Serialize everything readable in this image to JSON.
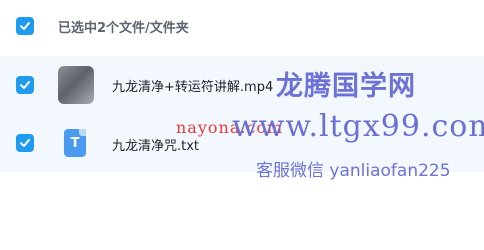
{
  "selection": {
    "summary": "已选中2个文件/文件夹",
    "all_checked": true
  },
  "files": [
    {
      "name": "九龙清净+转运符讲解.mp4",
      "type": "video",
      "checked": true
    },
    {
      "name": "九龙清净咒.txt",
      "type": "text",
      "icon_letter": "T",
      "checked": true
    }
  ],
  "watermark": {
    "title": "龙腾国学网",
    "url": "www.ltgx99.com",
    "red_text": "nayona.com",
    "service": "客服微信 yanliaofan225"
  },
  "colors": {
    "checkbox": "#1f9bf0",
    "row_highlight": "#f2f8fe",
    "watermark": "#6d72d8",
    "red_watermark": "#e83a3a"
  }
}
